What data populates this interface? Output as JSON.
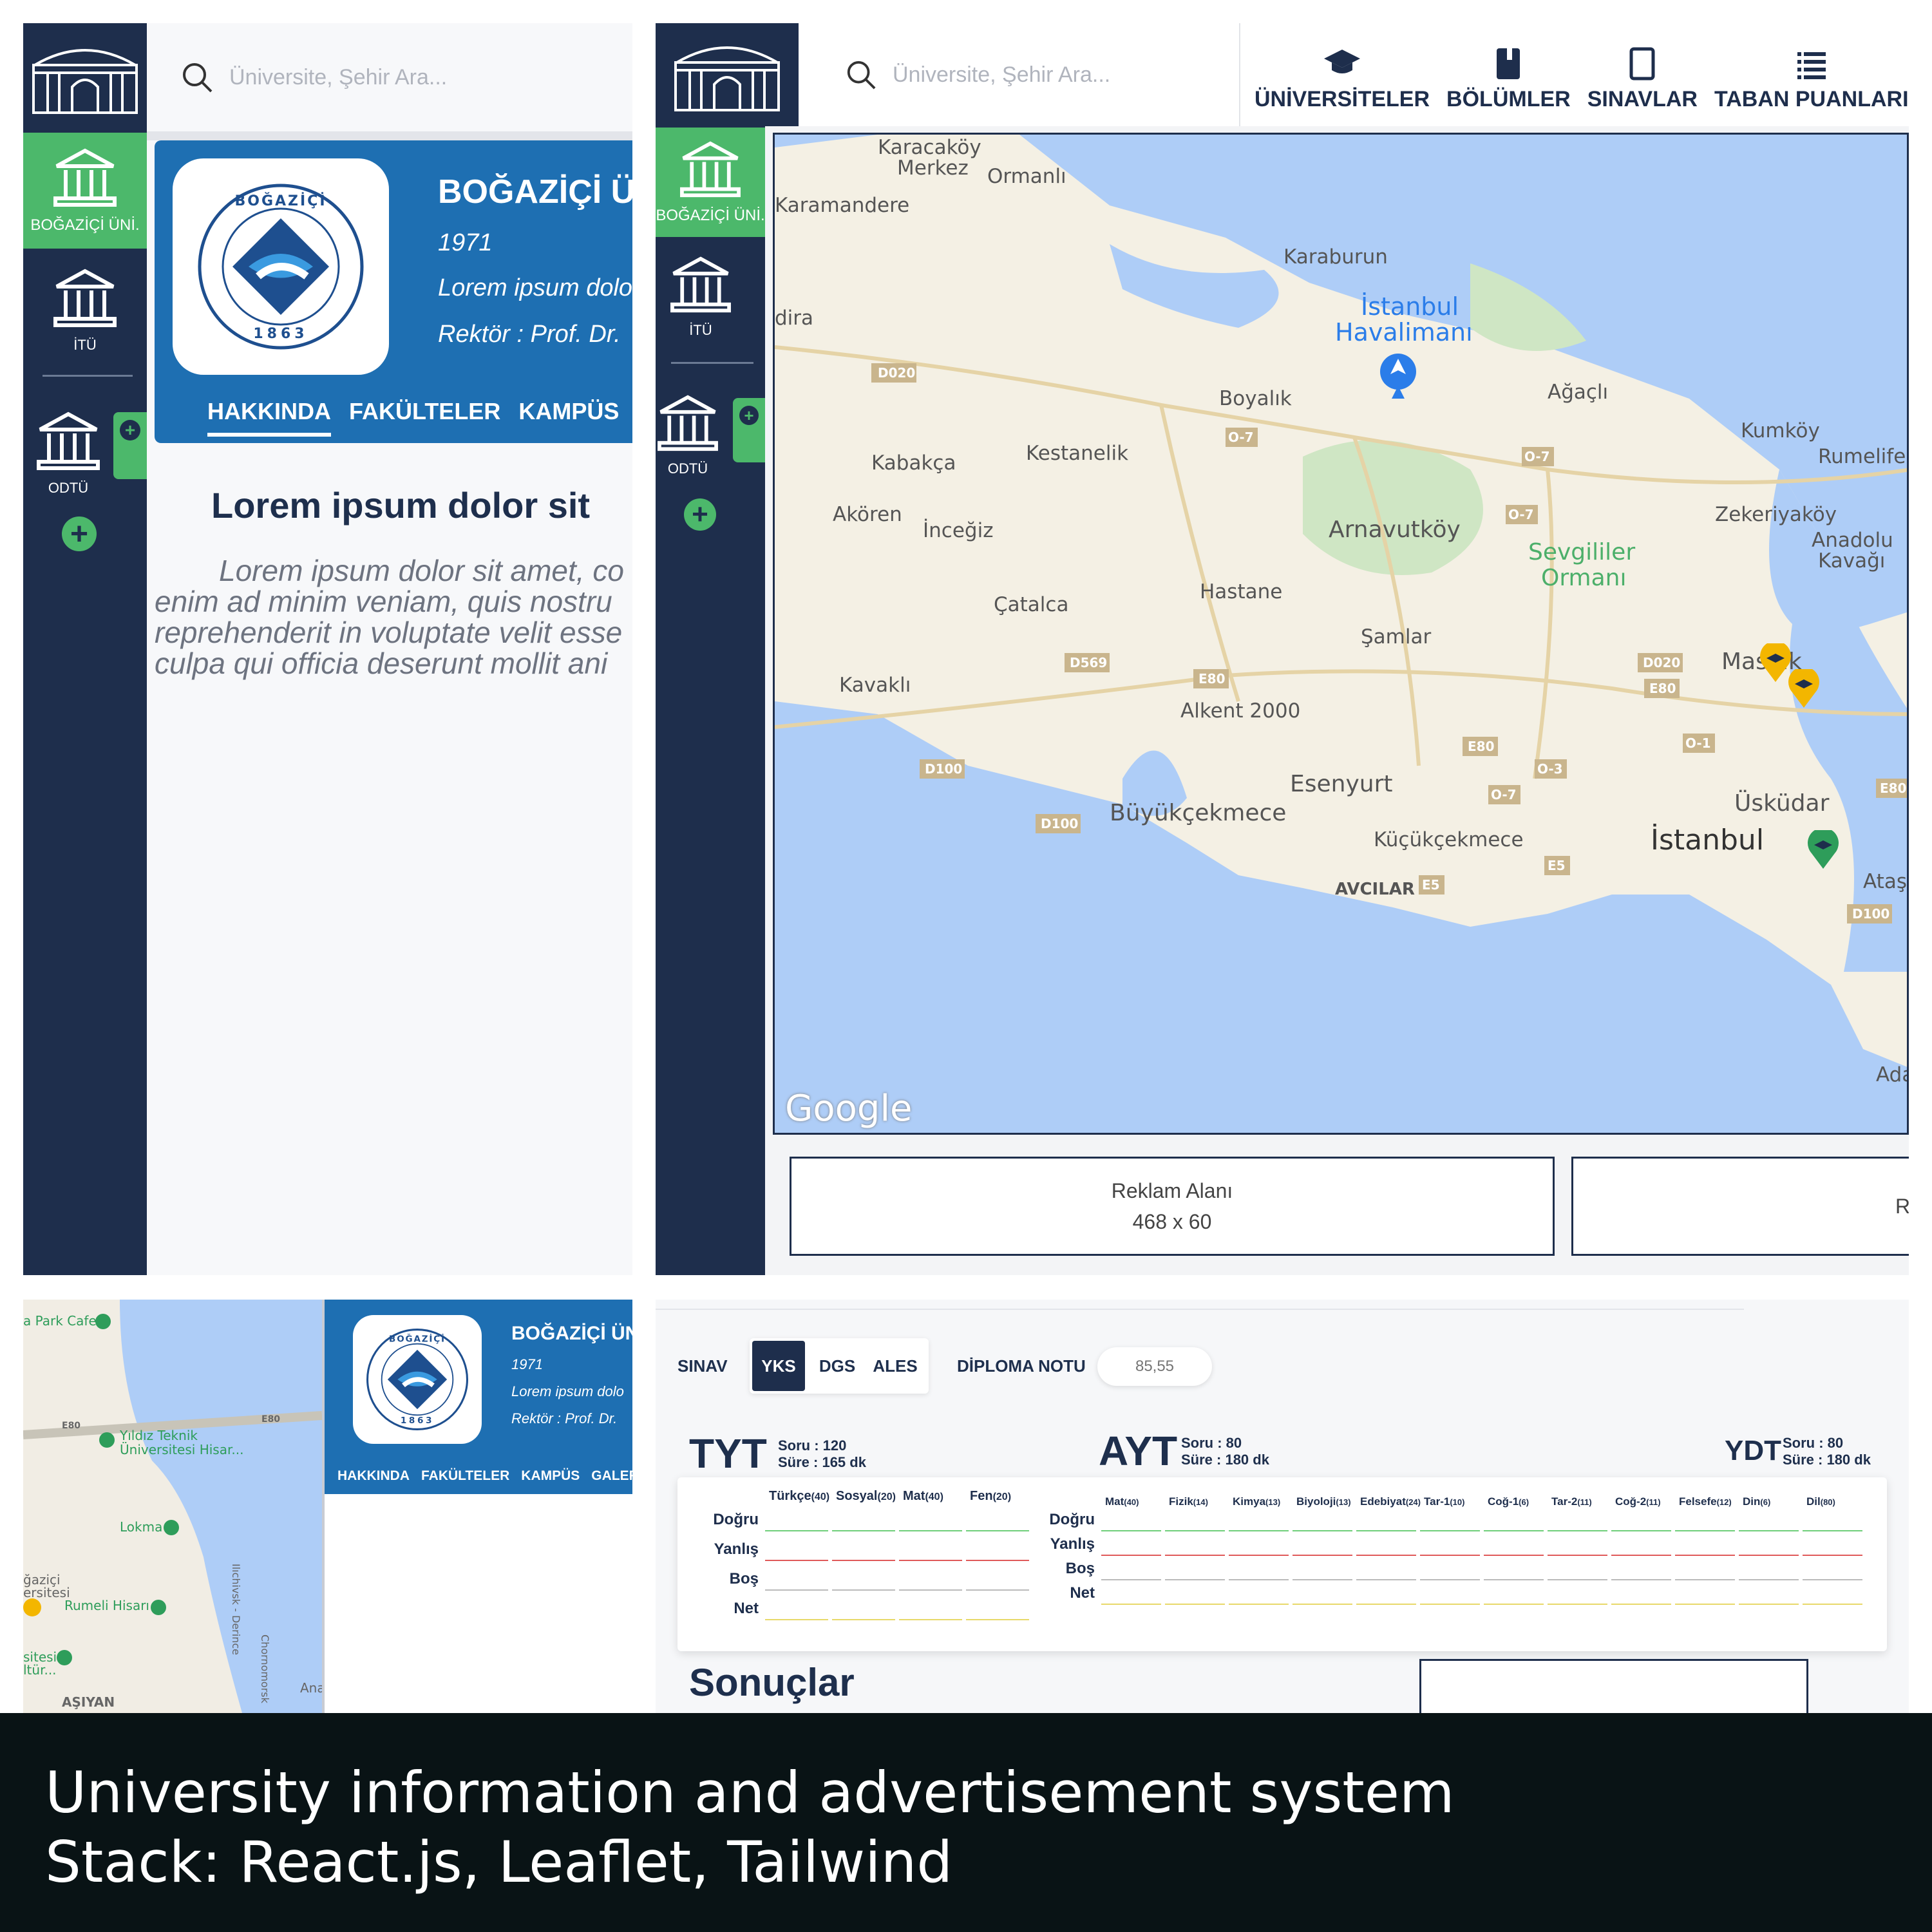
{
  "search": {
    "placeholder": "Üniversite, Şehir Ara..."
  },
  "sidebar": {
    "items": [
      {
        "label": "BOĞAZİÇİ ÜNİ.",
        "active": true
      },
      {
        "label": "İTÜ",
        "active": false
      },
      {
        "label": "ODTÜ",
        "active": false
      }
    ]
  },
  "university": {
    "name": "BOĞAZİÇİ ÜN",
    "year": "1971",
    "desc": "Lorem ipsum dolo",
    "rector": "Rektör : Prof. Dr.",
    "seal_text": "BOĞAZİÇİ ÜNİVERSİTESİ 1863"
  },
  "tabs": [
    "HAKKINDA",
    "FAKÜLTELER",
    "KAMPÜS",
    "GALERİ"
  ],
  "article": {
    "heading": "Lorem ipsum dolor sit",
    "lines": [
      "Lorem ipsum dolor sit amet, co",
      "enim ad minim veniam, quis nostru",
      "reprehenderit in voluptate velit esse",
      "culpa qui officia deserunt mollit ani"
    ]
  },
  "topnav": [
    {
      "label": "ÜNİVERSİTELER",
      "icon": "graduation-cap-icon"
    },
    {
      "label": "BÖLÜMLER",
      "icon": "book-icon"
    },
    {
      "label": "SINAVLAR",
      "icon": "tablet-icon"
    },
    {
      "label": "TABAN PUANLARI",
      "icon": "table-icon"
    }
  ],
  "map": {
    "labels": [
      "Karacaköy Merkez",
      "Ormanlı",
      "Karamandere",
      "Karaburun",
      "İstanbul Havalimanı",
      "Boyalık",
      "Ağaçlı",
      "Kumköy",
      "Rumelifer",
      "Kabakça",
      "Kestanelik",
      "Akören",
      "İnceğiz",
      "Arnavutköy",
      "Zekeriyaköy",
      "Anadolu Kavağı",
      "Sevgililer Ormanı",
      "Hastane",
      "Çatalca",
      "Şamlar",
      "Maslak",
      "Kavaklı",
      "Alkent 2000",
      "Esenyurt",
      "Büyükçekmece",
      "Küçükçekmece",
      "Üsküdar",
      "İstanbul",
      "AVCILAR",
      "Ataşe",
      "Ada",
      "dira"
    ],
    "roads": [
      "D020",
      "O-7",
      "O-7",
      "O-7",
      "O-7",
      "D569",
      "E80",
      "E80",
      "E80",
      "D100",
      "D100",
      "D020",
      "E80",
      "O-1",
      "O-3",
      "E5",
      "E5",
      "E80",
      "D100"
    ],
    "provider": "Google",
    "small_labels": [
      "a Park Cafe",
      "Yıldız Teknik Üniversitesi Hisar...",
      "Lokma",
      "Rumeli Hisarı",
      "ğaziçi ersitesi",
      "sitesi ltür...",
      "AŞIYAN",
      "Ana",
      "Ilıchivsk - Derince",
      "Chornomorsk",
      "E80"
    ]
  },
  "ads": [
    {
      "label": "Reklam Alanı",
      "size": "468 x 60"
    },
    {
      "label": "Re",
      "size": ""
    }
  ],
  "exam": {
    "sinav_label": "SINAV",
    "options": [
      "YKS",
      "DGS",
      "ALES"
    ],
    "selected": "YKS",
    "diploma_label": "DİPLOMA NOTU",
    "diploma_placeholder": "85,55",
    "tyt": {
      "title": "TYT",
      "soru": "Soru : 120",
      "sure": "Süre : 165 dk",
      "columns": [
        {
          "name": "Türkçe",
          "n": "(40)"
        },
        {
          "name": "Sosyal",
          "n": "(20)"
        },
        {
          "name": "Mat",
          "n": "(40)"
        },
        {
          "name": "Fen",
          "n": "(20)"
        }
      ]
    },
    "ayt": {
      "title": "AYT",
      "soru": "Soru : 80",
      "sure": "Süre : 180 dk",
      "columns": [
        {
          "name": "Mat",
          "n": "(40)"
        },
        {
          "name": "Fizik",
          "n": "(14)"
        },
        {
          "name": "Kimya",
          "n": "(13)"
        },
        {
          "name": "Biyoloji",
          "n": "(13)"
        },
        {
          "name": "Edebiyat",
          "n": "(24)"
        },
        {
          "name": "Tar-1",
          "n": "(10)"
        },
        {
          "name": "Coğ-1",
          "n": "(6)"
        },
        {
          "name": "Tar-2",
          "n": "(11)"
        },
        {
          "name": "Coğ-2",
          "n": "(11)"
        },
        {
          "name": "Felsefe",
          "n": "(12)"
        },
        {
          "name": "Din",
          "n": "(6)"
        },
        {
          "name": "Dil",
          "n": "(80)"
        }
      ]
    },
    "ydt": {
      "title": "YDT",
      "soru": "Soru : 80",
      "sure": "Süre : 180 dk"
    },
    "rows": [
      "Doğru",
      "Yanlış",
      "Boş",
      "Net"
    ],
    "row_colors": [
      "#6fcf7a",
      "#e05a5a",
      "#bbbbbb",
      "#e8d96a"
    ],
    "results_title": "Sonuçlar"
  },
  "caption": {
    "line1": "University information and advertisement system",
    "line2": "Stack: React.js, Leaflet, Tailwind"
  },
  "colors": {
    "navy": "#1e2e4c",
    "green": "#4cb86b",
    "blue": "#1e6fb2",
    "water": "#aecdf7"
  }
}
